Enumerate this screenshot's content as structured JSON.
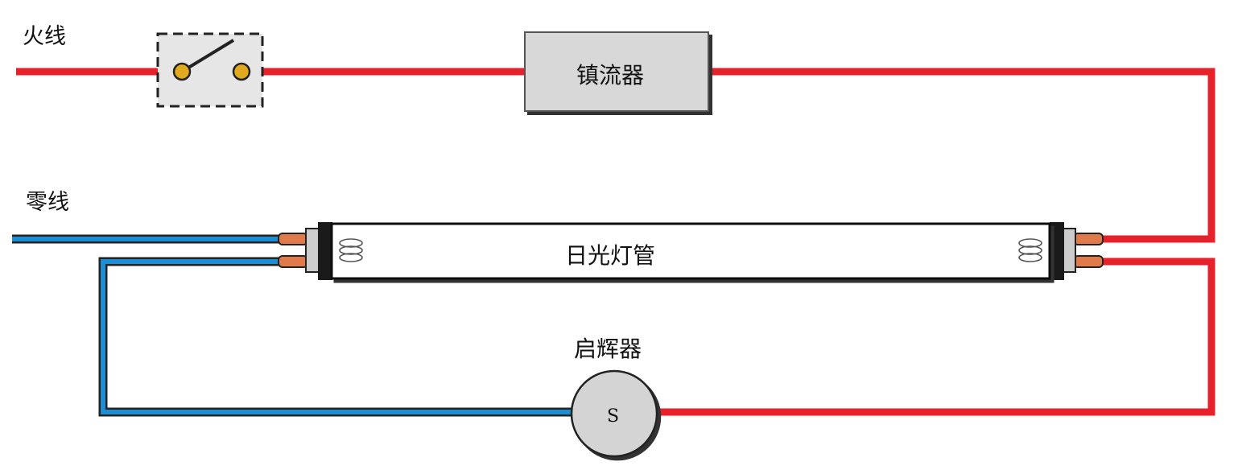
{
  "labels": {
    "live_wire": "火线",
    "neutral_wire": "零线",
    "ballast": "镇流器",
    "tube": "日光灯管",
    "starter": "启辉器",
    "starter_symbol": "S"
  },
  "colors": {
    "live": "#e8202a",
    "neutral": "#1a8ed6",
    "wire_outline": "#222222",
    "ballast_fill": "#d8d8d8",
    "switch_fill": "#e6e6e6",
    "contact": "#e0a91e",
    "pin": "#e07a4a",
    "starter_fill": "#d4d4d4",
    "tube_fill": "#ffffff"
  }
}
